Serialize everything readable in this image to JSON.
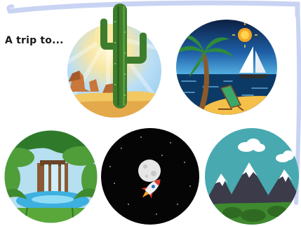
{
  "header": {
    "title": "A trip to..."
  },
  "colors": {
    "frame": "#c9d3f3",
    "desert_sky": "#8ec9ee",
    "ocean": "#0c3a66",
    "jungle_green": "#3f8a2e",
    "space": "#050505",
    "mountain_sky": "#48aab0"
  },
  "destinations": [
    {
      "id": "desert",
      "icon": "desert-cactus-scene"
    },
    {
      "id": "beach",
      "icon": "beach-palm-sailboat-scene"
    },
    {
      "id": "jungle",
      "icon": "jungle-waterfall-scene"
    },
    {
      "id": "space",
      "icon": "space-moon-rocket-scene"
    },
    {
      "id": "mountains",
      "icon": "snowy-mountains-scene"
    }
  ]
}
